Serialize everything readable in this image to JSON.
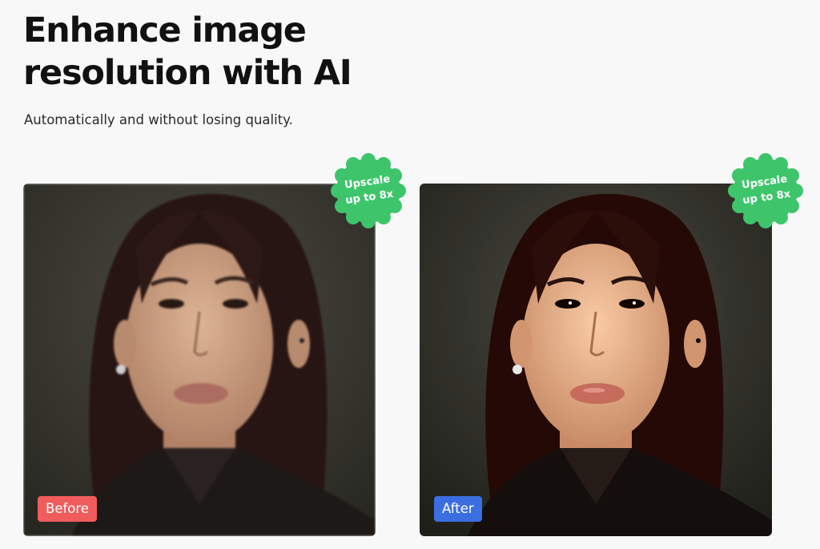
{
  "hero": {
    "title_line1": "Enhance image",
    "title_line2": "resolution with AI",
    "subtitle": "Automatically and without losing quality."
  },
  "comparison": {
    "before_label": "Before",
    "after_label": "After",
    "badge_line1": "Upscale",
    "badge_line2": "up to 8x"
  },
  "colors": {
    "page_background": "#f8f8f9",
    "badge_green": "#3ec56b",
    "before_label": "#f05c5c",
    "after_label": "#3b6ee0"
  },
  "icons": {
    "badge_shape": "scalloped-circle",
    "photos": "portrait-photo"
  }
}
